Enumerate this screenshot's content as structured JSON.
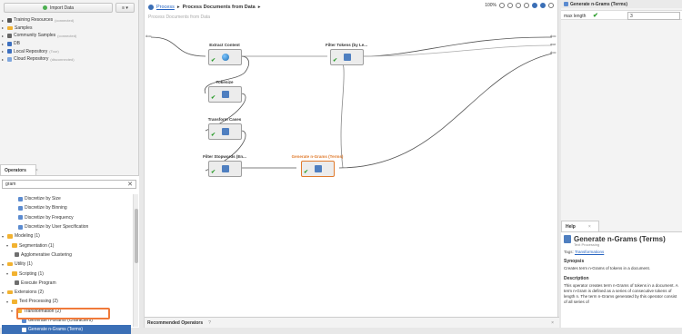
{
  "repository": {
    "import_label": "Import Data",
    "menu_label": "≡ ▾",
    "items": [
      {
        "label": "Training Resources",
        "note": "(connected)",
        "icon": "training-folder-icon"
      },
      {
        "label": "Samples",
        "note": "",
        "icon": "folder-icon"
      },
      {
        "label": "Community Samples",
        "note": "(connected)",
        "icon": "community-folder-icon"
      },
      {
        "label": "DB",
        "note": "",
        "icon": "db-icon"
      },
      {
        "label": "Local Repository",
        "note": "(Tour)",
        "icon": "local-repo-icon"
      },
      {
        "label": "Cloud Repository",
        "note": "(disconnected)",
        "icon": "cloud-icon"
      }
    ]
  },
  "operators": {
    "tab_label": "Operators",
    "tab_close": "×",
    "search_value": "gram",
    "tree": [
      {
        "label": "Discretize by Size",
        "indent": 3,
        "icon": "operator-icon"
      },
      {
        "label": "Discretize by Binning",
        "indent": 3,
        "icon": "operator-icon"
      },
      {
        "label": "Discretize by Frequency",
        "indent": 3,
        "icon": "operator-icon"
      },
      {
        "label": "Discretize by User Specification",
        "indent": 3,
        "icon": "operator-icon"
      },
      {
        "label": "Modeling (1)",
        "indent": 0,
        "icon": "folder-icon"
      },
      {
        "label": "Segmentation (1)",
        "indent": 1,
        "icon": "folder-icon"
      },
      {
        "label": "Agglomerative Clustering",
        "indent": 2,
        "icon": "operator-icon"
      },
      {
        "label": "Utility (1)",
        "indent": 0,
        "icon": "folder-icon"
      },
      {
        "label": "Scripting (1)",
        "indent": 1,
        "icon": "folder-icon"
      },
      {
        "label": "Execute Program",
        "indent": 2,
        "icon": "operator-icon"
      },
      {
        "label": "Extensions (2)",
        "indent": 0,
        "icon": "folder-icon"
      },
      {
        "label": "Text Processing (2)",
        "indent": 1,
        "icon": "folder-icon"
      },
      {
        "label": "Transformation (2)",
        "indent": 2,
        "icon": "folder-icon"
      },
      {
        "label": "Generate n-Grams (Characters)",
        "indent": 3,
        "icon": "operator-icon"
      },
      {
        "label": "Generate n-Grams (Terms)",
        "indent": 3,
        "icon": "operator-icon",
        "selected": true
      }
    ]
  },
  "process": {
    "breadcrumb_root": "Process",
    "breadcrumb_sep": "▸",
    "breadcrumb_current": "Process Documents from Data",
    "breadcrumb_end": "▸",
    "zoom": "100%",
    "canvas_title": "Process Documents from Data",
    "ports": {
      "left_top": "doc",
      "left_bottom": "",
      "right_top": "doc",
      "right_mid": "wor",
      "right_bottom": "doc"
    },
    "operators": [
      {
        "name": "Extract Content",
        "highlight": false
      },
      {
        "name": "Tokenize",
        "highlight": false
      },
      {
        "name": "Transform Cases",
        "highlight": false
      },
      {
        "name": "Filter Stopwords (En...",
        "highlight": false
      },
      {
        "name": "Filter Tokens (by Le...",
        "highlight": false
      },
      {
        "name": "Generate n-Grams (Terms)",
        "highlight": true
      }
    ]
  },
  "recommended": {
    "label": "Recommended Operators",
    "help": "?",
    "close": "×"
  },
  "parameters": {
    "title": "Generate n-Grams (Terms)",
    "param_label": "max length",
    "param_value": "3"
  },
  "help": {
    "tab_label": "Help",
    "tab_close": "×",
    "title": "Generate n-Grams (Terms)",
    "subtitle": "Text Processing",
    "tags_label": "Tags:",
    "tags_value": "Transformations",
    "synopsis_heading": "Synopsis",
    "synopsis": "Creates term n-Grams of tokens in a document.",
    "description_heading": "Description",
    "description": "This operator creates term n-Grams of tokens in a document. A term n-Gram is defined as a series of consecutive tokens of length n. The term n-Grams generated by this operator consist of all series of"
  },
  "colors": {
    "accent": "#3b6fb6",
    "highlight": "#f07a3a",
    "ok": "#2a9c2a"
  }
}
